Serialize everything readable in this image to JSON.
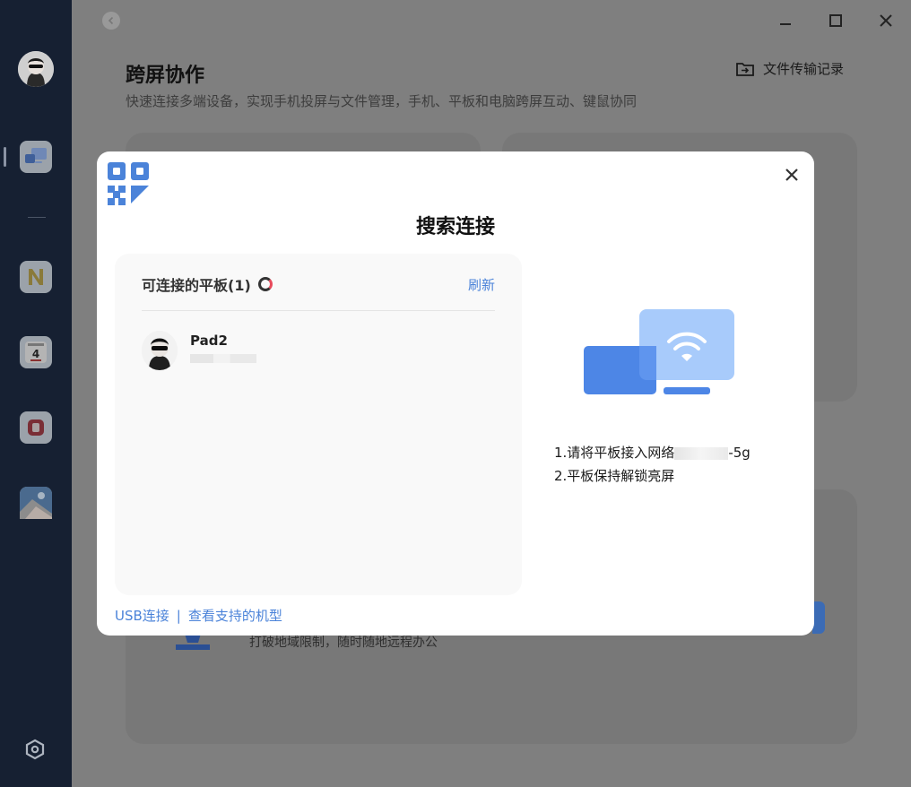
{
  "page": {
    "title": "跨屏协作",
    "subtitle": "快速连接多端设备，实现手机投屏与文件管理，手机、平板和电脑跨屏互动、键鼠协同",
    "transfer_log": "文件传输记录",
    "background_hint": "打破地域限制，随时随地远程办公"
  },
  "sidebar": {
    "items": [
      {
        "name": "avatar"
      },
      {
        "name": "cross-screen-app",
        "active": true
      },
      {
        "name": "notes-app"
      },
      {
        "name": "calendar-app",
        "day": "4",
        "label": "星期四"
      },
      {
        "name": "office-app"
      },
      {
        "name": "gallery-app"
      }
    ]
  },
  "dialog": {
    "title": "搜索连接",
    "list_header": "可连接的平板(1)",
    "refresh": "刷新",
    "devices": [
      {
        "name": "Pad2"
      }
    ],
    "instructions": {
      "line1_prefix": "1.请将平板接入网络",
      "line1_suffix": "-5g",
      "line2": "2.平板保持解锁亮屏"
    },
    "footer": {
      "usb": "USB连接",
      "separator": "|",
      "supported": "查看支持的机型"
    }
  },
  "colors": {
    "accent": "#4b83d9",
    "sidebar_bg": "#162032",
    "overlay_bg": "#7f7f7f",
    "loading_red": "#e84b5c"
  }
}
